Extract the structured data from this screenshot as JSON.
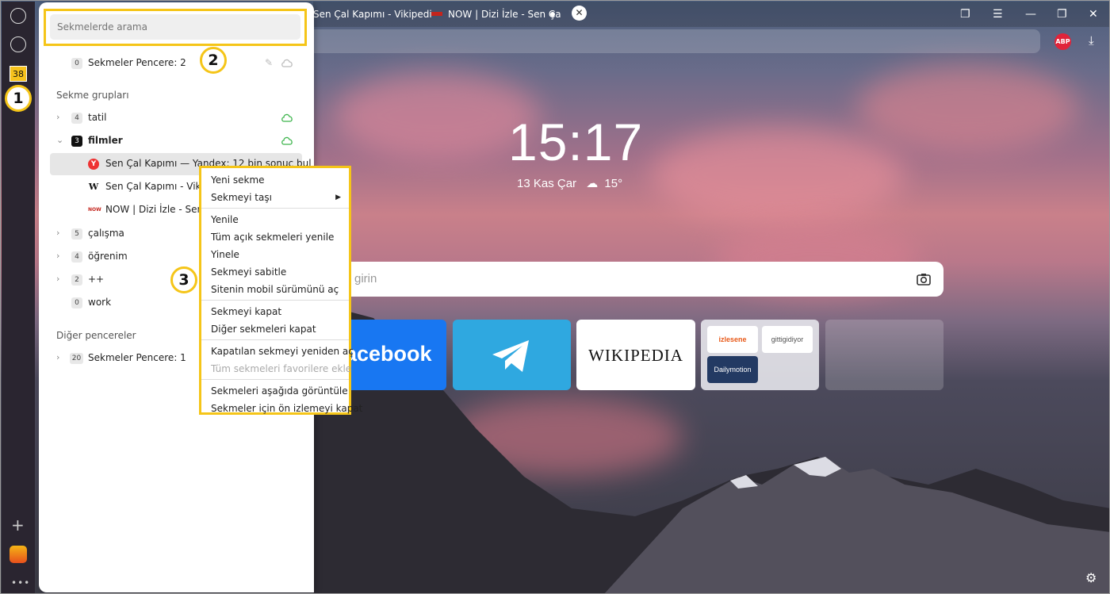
{
  "tabs": {
    "tab1_title": "Sen Çal Kapımı - Vikipedi",
    "tab2_title": "NOW | Dizi İzle - Sen Ça"
  },
  "badges": {
    "tab_count": "38",
    "abp": "ABP"
  },
  "callouts": [
    "1",
    "2",
    "3"
  ],
  "new_tab": {
    "time": "15:17",
    "date": "13 Kas Çar",
    "temperature": "15°",
    "search_placeholder_visible": "girin",
    "tiles": {
      "facebook": "acebook",
      "wikipedia": "WIKIPEDIA",
      "multi_izlesene": "izlesene",
      "multi_gittigidiyor": "gittigidiyor",
      "multi_dailymotion": "Dailymotion"
    }
  },
  "panel": {
    "search_placeholder": "Sekmelerde arama",
    "current_window": {
      "count": "0",
      "label": "Sekmeler Pencere: 2"
    },
    "groups_header": "Sekme grupları",
    "groups": [
      {
        "count": "4",
        "label": "tatil"
      },
      {
        "count": "3",
        "label": "filmler"
      },
      {
        "count": "5",
        "label": "çalışma"
      },
      {
        "count": "4",
        "label": "öğrenim"
      },
      {
        "count": "2",
        "label": "++"
      },
      {
        "count": "0",
        "label": "work"
      }
    ],
    "film_tabs": [
      {
        "icon": "Y",
        "label": "Sen Çal Kapımı — Yandex: 12 bin sonuç bul"
      },
      {
        "icon": "W",
        "label": "Sen Çal Kapımı - Vikipe"
      },
      {
        "icon": "NOW",
        "label": "NOW | Dizi İzle - Sen Ça"
      }
    ],
    "other_header": "Diğer pencereler",
    "other_windows": [
      {
        "count": "20",
        "label": "Sekmeler Pencere: 1"
      }
    ]
  },
  "context_menu": {
    "items": [
      "Yeni sekme",
      "Sekmeyi taşı",
      "Yenile",
      "Tüm açık sekmeleri yenile",
      "Yinele",
      "Sekmeyi sabitle",
      "Sitenin mobil sürümünü aç",
      "Sekmeyi kapat",
      "Diğer sekmeleri kapat",
      "Kapatılan sekmeyi yeniden aç",
      "Tüm sekmeleri favorilere ekle",
      "Sekmeleri aşağıda görüntüle",
      "Sekmeler için ön izlemeyi kapat"
    ]
  },
  "colors": {
    "highlight": "#f5c518",
    "facebook": "#1877f2",
    "telegram": "#2fa8e0",
    "cloud_synced": "#3cb44b"
  }
}
